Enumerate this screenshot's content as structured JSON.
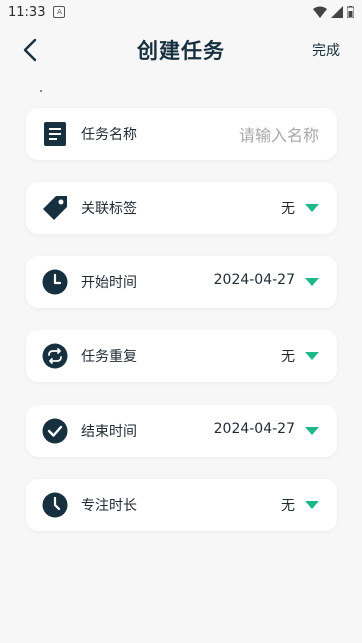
{
  "status_bar": {
    "time": "11:33",
    "notification_glyph": "A"
  },
  "header": {
    "title": "创建任务",
    "done_label": "完成"
  },
  "form": {
    "name": {
      "label": "任务名称",
      "placeholder": "请输入名称",
      "value": ""
    },
    "tag": {
      "label": "关联标签",
      "value": "无"
    },
    "start_time": {
      "label": "开始时间",
      "value": "2024-04-27"
    },
    "repeat": {
      "label": "任务重复",
      "value": "无"
    },
    "end_time": {
      "label": "结束时间",
      "value": "2024-04-27"
    },
    "focus_duration": {
      "label": "专注时长",
      "value": "无"
    }
  },
  "colors": {
    "accent": "#1db98a",
    "icon_dark": "#17303f",
    "card_bg": "#ffffff",
    "page_bg": "#f7f7f7"
  },
  "icons": [
    "back-arrow-icon",
    "document-icon",
    "tag-icon",
    "clock-icon",
    "repeat-icon",
    "check-circle-icon",
    "timer-icon",
    "caret-down-icon",
    "wifi-icon",
    "signal-icon",
    "battery-icon"
  ]
}
